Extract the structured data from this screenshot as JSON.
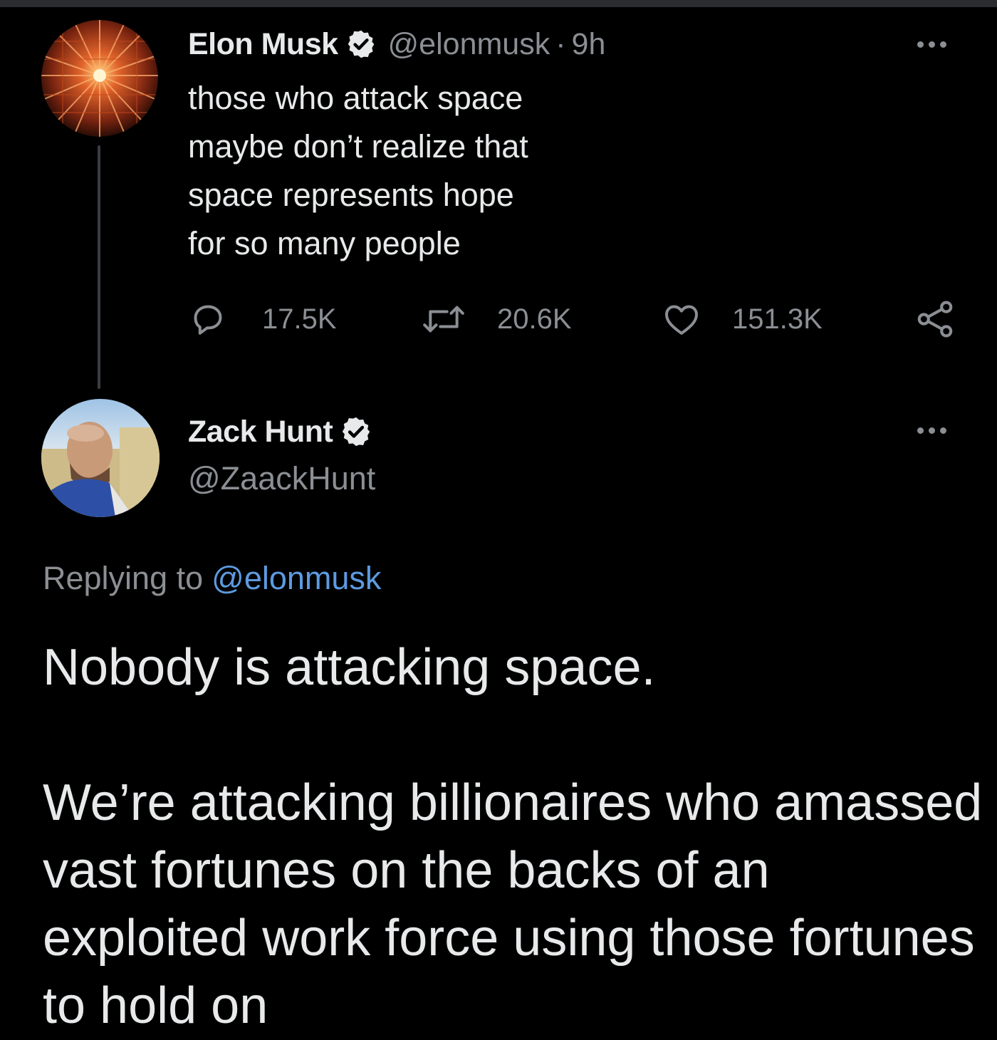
{
  "colors": {
    "background": "#000000",
    "text_primary": "#e7e9ea",
    "text_secondary": "#8b8f94",
    "link": "#5d9ae0",
    "verified_badge": "#e7e9ea"
  },
  "parent_tweet": {
    "author_name": "Elon Musk",
    "author_handle": "@elonmusk",
    "separator": "·",
    "timestamp": "9h",
    "verified_icon": "verified-badge-icon",
    "text": "those who attack space\nmaybe don’t realize that\nspace represents hope\nfor so many people",
    "replies": "17.5K",
    "retweets": "20.6K",
    "likes": "151.3K",
    "icons": [
      "reply-icon",
      "retweet-icon",
      "like-icon",
      "share-icon",
      "more-icon"
    ]
  },
  "reply_tweet": {
    "author_name": "Zack Hunt",
    "author_handle": "@ZaackHunt",
    "replying_label": "Replying to",
    "replying_to": "@elonmusk",
    "paragraph_1": "Nobody is attacking space.",
    "paragraph_2": "We’re attacking billionaires who amassed vast fortunes on the backs of an exploited work force using those fortunes to hold on"
  }
}
